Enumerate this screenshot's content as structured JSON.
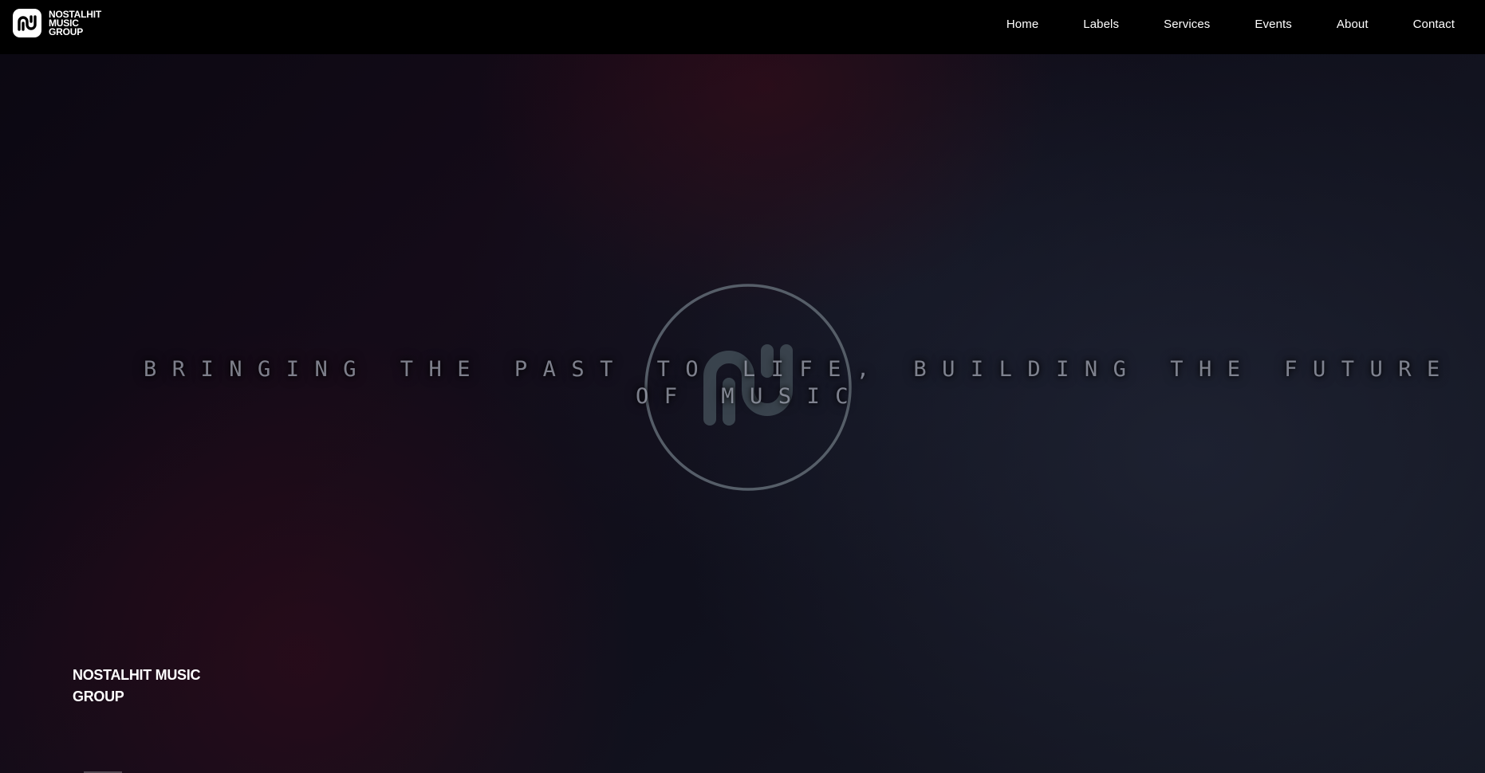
{
  "header": {
    "brand_name": "NOSTALHIT\nMUSIC\nGROUP",
    "nav": [
      {
        "label": "Home"
      },
      {
        "label": "Labels"
      },
      {
        "label": "Services"
      },
      {
        "label": "Events"
      },
      {
        "label": "About"
      },
      {
        "label": "Contact"
      }
    ]
  },
  "hero": {
    "tagline_line1": "BRINGING THE PAST TO LIFE, BUILDING THE FUTURE",
    "tagline_line2": "OF MUSIC",
    "brand_footer": "NOSTALHIT MUSIC GROUP"
  },
  "colors": {
    "header_bg": "#000000",
    "text": "#ffffff",
    "logo_ring": "#5d6670"
  },
  "icons": {
    "brand_logo": "nostalhit-logo-icon",
    "hero_logo": "nostalhit-circle-logo-icon"
  }
}
